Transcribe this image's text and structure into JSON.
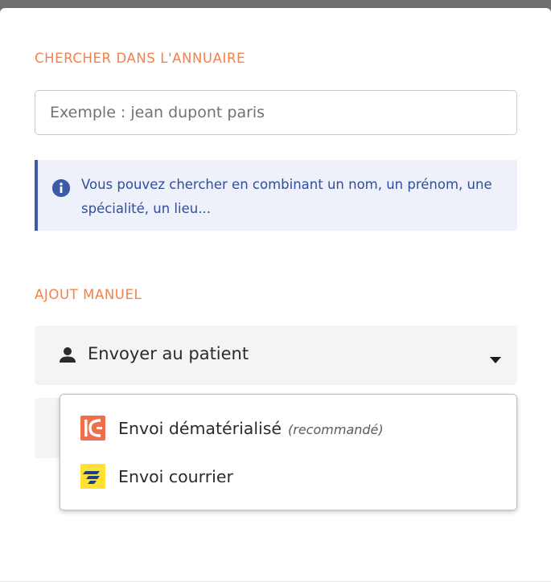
{
  "search": {
    "section_title": "CHERCHER DANS L'ANNUAIRE",
    "placeholder": "Exemple : jean dupont paris",
    "value": "",
    "info_text": "Vous pouvez chercher en combinant un nom, un prénom, une spécialité, un lieu...",
    "info_icon": "info-icon"
  },
  "manual": {
    "section_title": "AJOUT MANUEL",
    "selected_label": "Envoyer au patient",
    "selected_icon": "person-icon",
    "dropdown_icon": "caret-down-icon",
    "options": [
      {
        "label": "Envoi dématérialisé",
        "note": "(recommandé)",
        "icon": "lifen-logo-icon"
      },
      {
        "label": "Envoi courrier",
        "note": "",
        "icon": "la-poste-logo-icon"
      }
    ]
  },
  "colors": {
    "accent": "#f5804a",
    "info_blue": "#3d5aa9",
    "info_bg": "#eef0fa",
    "select_bg": "#f4f4f6",
    "lifen_orange": "#f16e4a",
    "poste_yellow": "#ffe033",
    "poste_blue": "#1a3e91"
  }
}
